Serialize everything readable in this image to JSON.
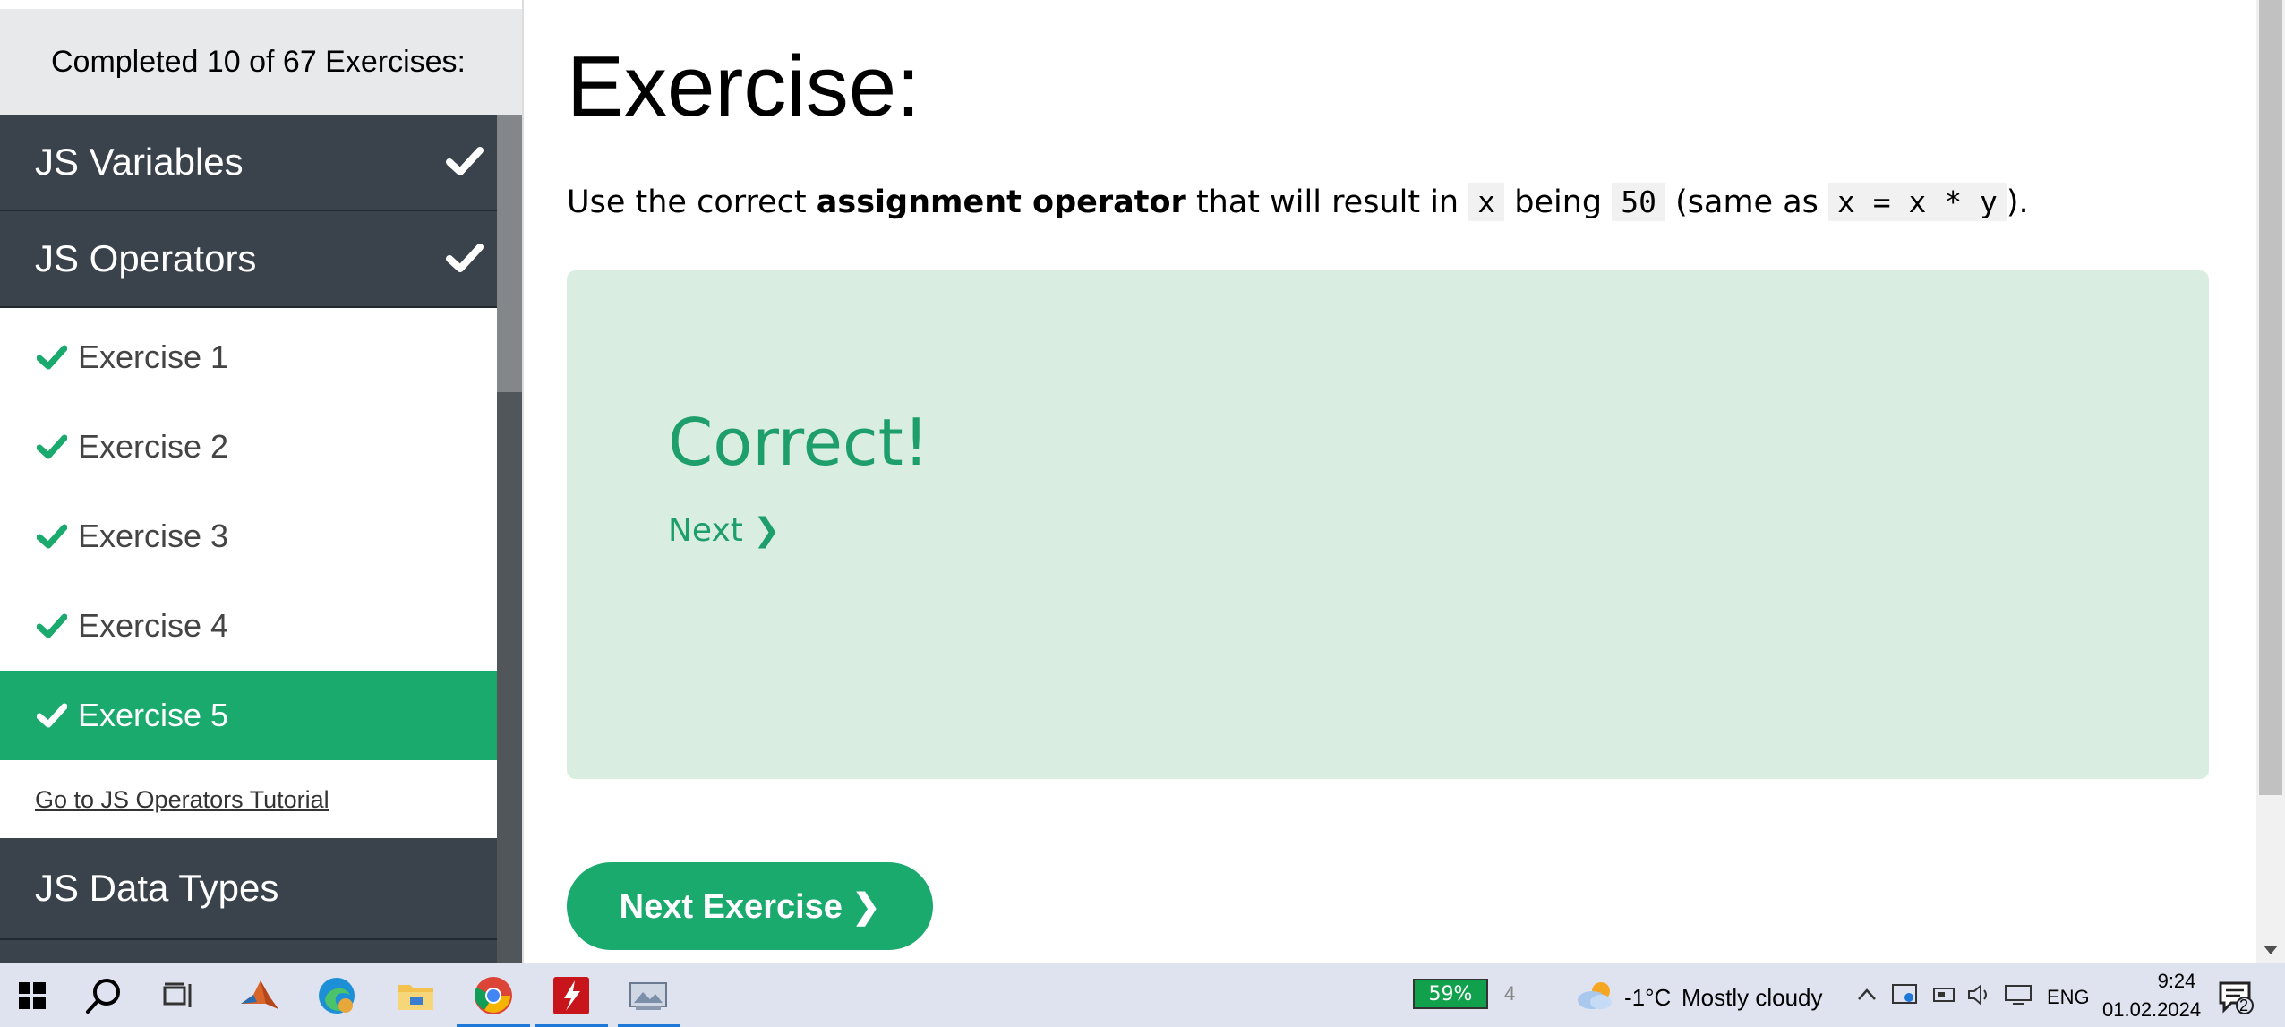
{
  "sidebar": {
    "progress_text": "Completed 10 of 67 Exercises:",
    "chapters": [
      {
        "label": "JS Variables",
        "completed": true
      },
      {
        "label": "JS Operators",
        "completed": true
      },
      {
        "label": "JS Data Types",
        "completed": false
      }
    ],
    "exercises": [
      {
        "label": "Exercise 1",
        "active": false
      },
      {
        "label": "Exercise 2",
        "active": false
      },
      {
        "label": "Exercise 3",
        "active": false
      },
      {
        "label": "Exercise 4",
        "active": false
      },
      {
        "label": "Exercise 5",
        "active": true
      }
    ],
    "tutorial_link": "Go to JS Operators Tutorial"
  },
  "main": {
    "title": "Exercise:",
    "instruction": {
      "p1": "Use the correct ",
      "bold": "assignment operator",
      "p2": " that will result in ",
      "code1": "x",
      "p3": " being ",
      "code2": "50",
      "p4": " (same as ",
      "code3": "x = x * y",
      "p5": ")."
    },
    "result": {
      "heading": "Correct!",
      "next_label": "Next ❯"
    },
    "next_exercise_label": "Next Exercise ❯"
  },
  "taskbar": {
    "battery": "59%",
    "battery_extra": "4",
    "temperature": "-1°C",
    "weather": "Mostly cloudy",
    "language": "ENG",
    "time": "9:24",
    "date": "01.02.2024",
    "notifications": "2"
  },
  "colors": {
    "accent": "#1aaa6e",
    "sidebar_dark": "#3a434b",
    "result_bg": "#d9eee1",
    "correct_text": "#1d9e6a"
  }
}
